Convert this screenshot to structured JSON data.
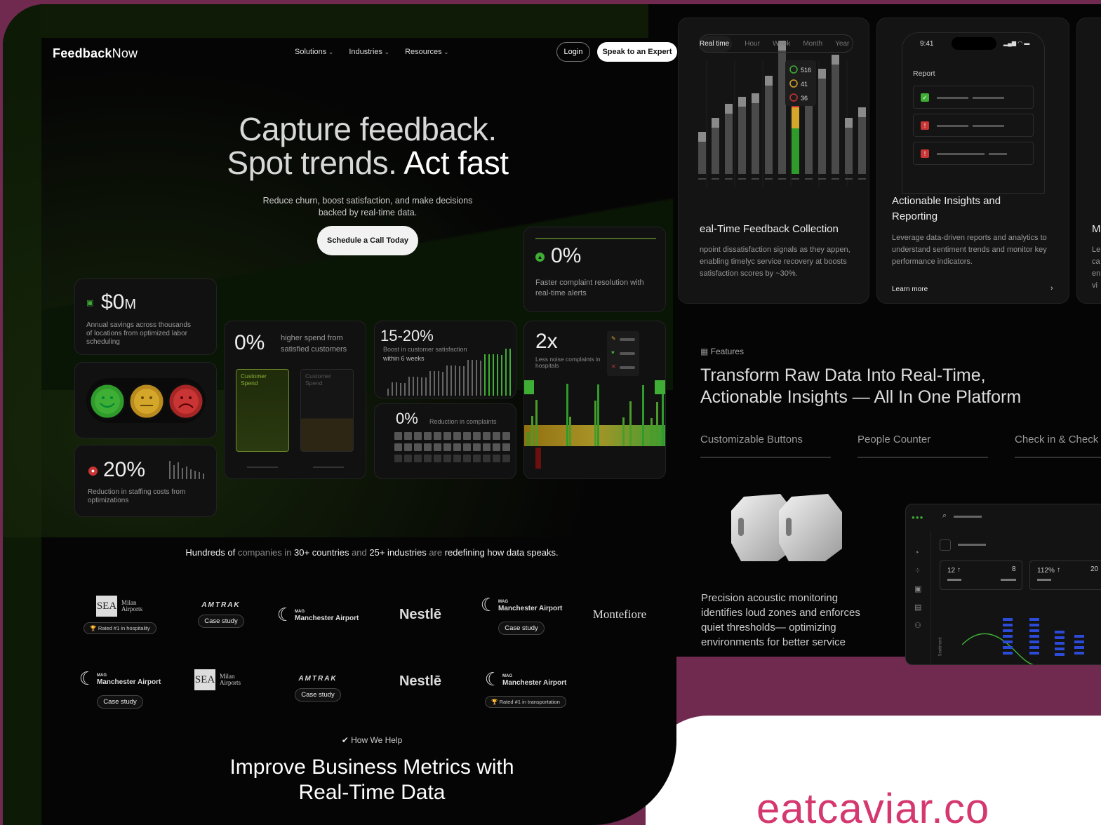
{
  "site": {
    "logo_bold": "Feedback",
    "logo_light": "Now"
  },
  "nav": {
    "solutions": "Solutions",
    "industries": "Industries",
    "resources": "Resources",
    "login": "Login",
    "expert": "Speak to an Expert"
  },
  "hero": {
    "line1": "Capture feedback.",
    "line2a": "Spot trends. ",
    "line2b": "Act fast",
    "sub1": "Reduce churn, boost satisfaction, and make decisions",
    "sub2": "backed by real-time data.",
    "cta": "Schedule a Call Today"
  },
  "stats": {
    "savings": {
      "value": "$0",
      "unit": "M",
      "desc": "Annual savings across thousands of locations from optimized labor scheduling"
    },
    "staffing": {
      "value": "20%",
      "desc": "Reduction in staffing costs from optimizations"
    },
    "spend": {
      "value": "0%",
      "desc": "higher spend from satisfied customers",
      "bar1": "Customer Spend",
      "bar2": "Customer Spend"
    },
    "boost": {
      "value": "15-20%",
      "desc": "Boost in customer satisfaction",
      "desc2": "within 6 weeks"
    },
    "complaints": {
      "value": "0%",
      "desc": "Reduction in complaints"
    },
    "noise": {
      "value": "2x",
      "desc": "Less noise complaints in hospitals"
    },
    "resolution": {
      "value": "0%",
      "desc": "Faster complaint resolution with real-time alerts"
    }
  },
  "logos_line": {
    "a": "Hundreds of ",
    "b": "companies in ",
    "c": "30+ countries ",
    "d": "and ",
    "e": "25+ industries ",
    "f": "are ",
    "g": "redefining how data speaks."
  },
  "logos": {
    "sea": "SEA",
    "milan": "Milan Airports",
    "amtrak": "AMTRAK",
    "mag": "MAG",
    "manchester": "Manchester Airport",
    "nestle": "Nestlē",
    "montefiore": "Montefiore",
    "case_study": "Case study",
    "rated_hosp": "Rated #1 in hospitality",
    "rated_trans": "Rated #1 in transportation"
  },
  "help": {
    "tag": "How We Help",
    "title1": "Improve Business Metrics with",
    "title2": "Real-Time Data"
  },
  "right": {
    "tabs": [
      "Real time",
      "Hour",
      "Week",
      "Month",
      "Year"
    ],
    "legend": [
      "516",
      "41",
      "36"
    ],
    "rtf_title": "eal-Time Feedback Collection",
    "rtf_desc": "npoint dissatisfaction signals as they appen, enabling timelyc service recovery at boosts satisfaction scores by ~30%.",
    "phone_time": "9:41",
    "report": "Report",
    "ai_title": "Actionable Insights and Reporting",
    "ai_desc": "Leverage data-driven reports and analytics to understand sentiment trends and monitor key performance indicators.",
    "learn_more": "Learn more",
    "cut_letters": [
      "M",
      "Le",
      "ca",
      "en",
      "vi"
    ],
    "features_tag": "Features",
    "features_title1": "Transform Raw Data Into Real-Time,",
    "features_title2": "Actionable Insights — All In One Platform",
    "ftabs": [
      "Customizable Buttons",
      "People Counter",
      "Check in & Check out"
    ],
    "acoustic": "Precision acoustic monitoring identifies loud zones and enforces quiet thresholds— optimizing environments for better service",
    "dash": {
      "v1": "12",
      "v2": "8",
      "v3": "112%",
      "v4": "20",
      "axis": "Sentiment"
    }
  },
  "watermark": "eatcaviar.co",
  "colors": {
    "accent_green": "#3fae35",
    "mid_yellow": "#d4a62a",
    "bad_red": "#c93434",
    "brand_pink": "#d4386e",
    "frame": "#702a4f"
  }
}
